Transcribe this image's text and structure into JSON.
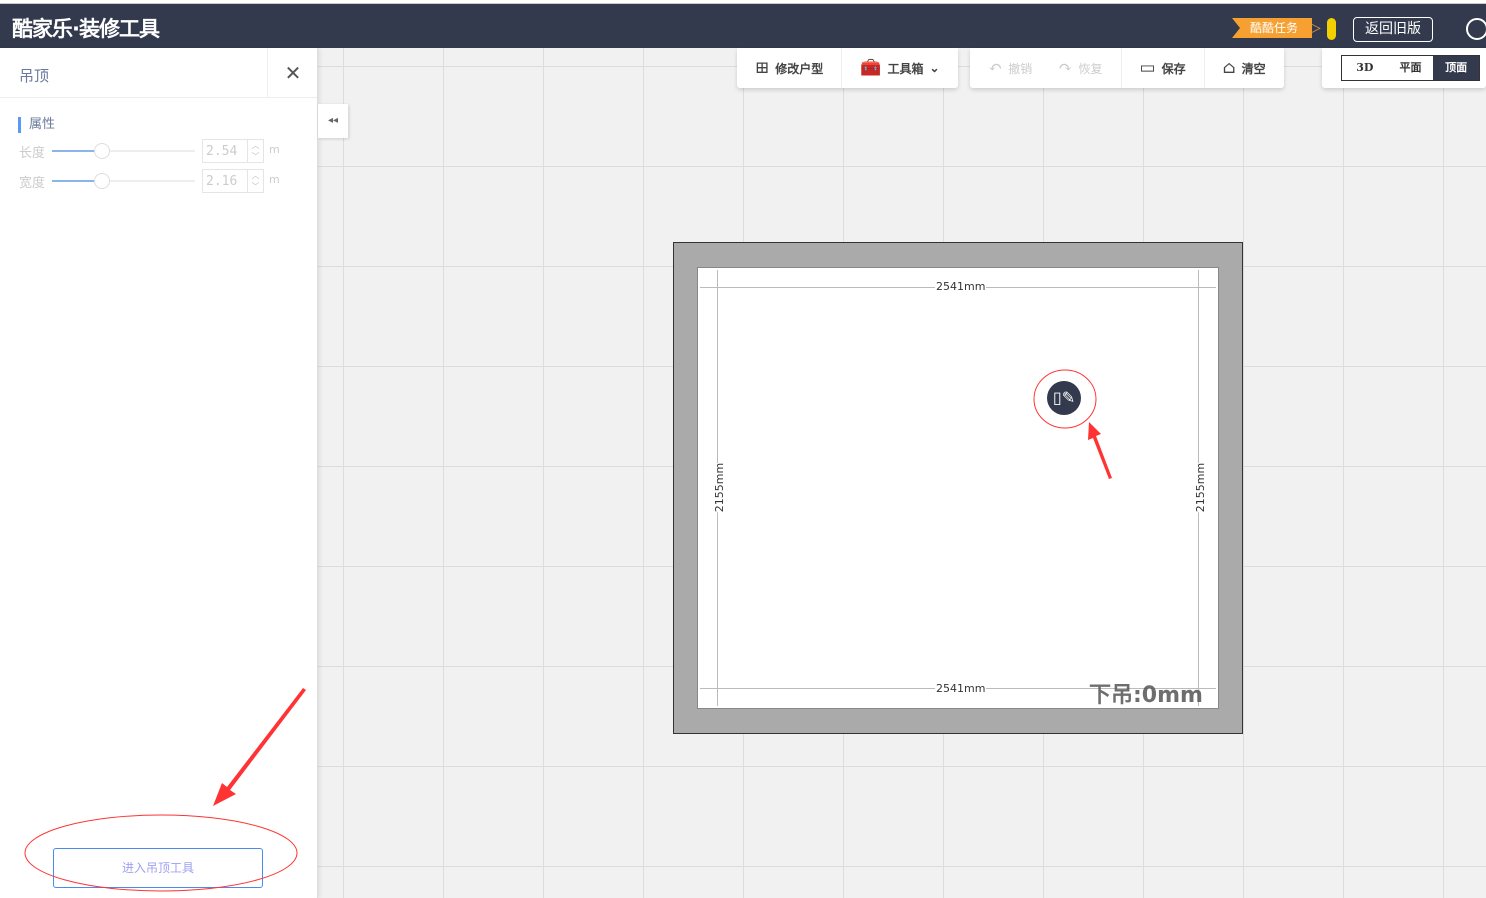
{
  "header": {
    "logo": "酷家乐·装修工具",
    "task_label": "酷酷任务",
    "old_version": "返回旧版"
  },
  "sidebar": {
    "title": "吊顶",
    "section": "属性",
    "props": [
      {
        "label": "长度",
        "value": "2.54",
        "unit": "m",
        "slider": 0.35
      },
      {
        "label": "宽度",
        "value": "2.16",
        "unit": "m",
        "slider": 0.35
      }
    ],
    "enter_button": "进入吊顶工具"
  },
  "toolbar": {
    "edit_layout": "修改户型",
    "toolbox": "工具箱",
    "undo": "撤销",
    "redo": "恢复",
    "save": "保存",
    "clear": "清空"
  },
  "views": {
    "v3d": "3D",
    "plan": "平面",
    "ceiling": "顶面",
    "active": "顶面"
  },
  "room": {
    "width_top": "2541mm",
    "width_bottom": "2541mm",
    "height_left": "2155mm",
    "height_right": "2155mm",
    "drop": "下吊:0mm"
  },
  "colors": {
    "topbar": "#333a4d",
    "accent": "#4a8af0",
    "annotation": "#ff3333"
  }
}
